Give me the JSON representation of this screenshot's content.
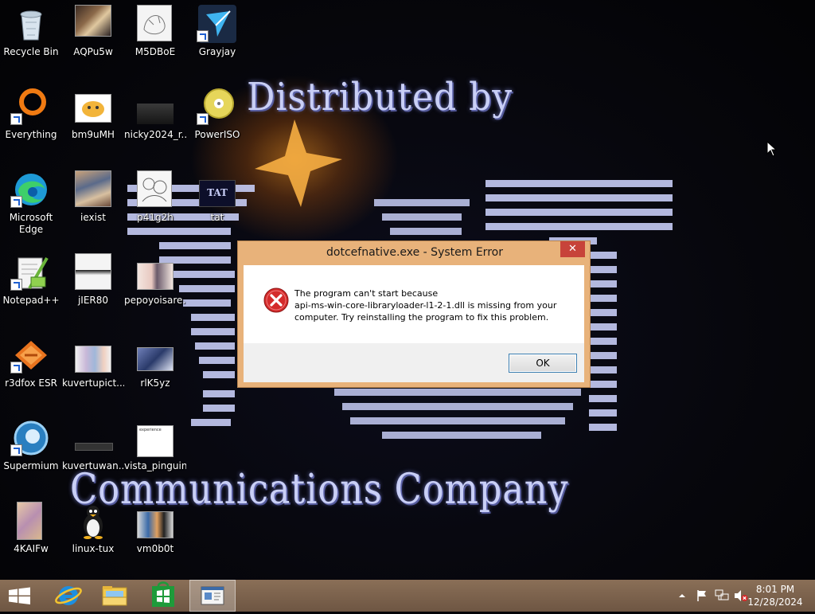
{
  "wallpaper": {
    "line_top": "Distributed by",
    "line_bottom": "Communications Company"
  },
  "desktop_icons": [
    {
      "label": "Recycle Bin",
      "icon": "recycle-bin-icon"
    },
    {
      "label": "AQPu5w",
      "icon": "image-thumbnail-icon"
    },
    {
      "label": "M5DBoE",
      "icon": "image-thumbnail-icon"
    },
    {
      "label": "Grayjay",
      "icon": "grayjay-icon"
    },
    {
      "label": "Everything",
      "icon": "everything-search-icon"
    },
    {
      "label": "bm9uMH",
      "icon": "image-thumbnail-icon"
    },
    {
      "label": "nicky2024_r...",
      "icon": "image-thumbnail-icon"
    },
    {
      "label": "PowerISO",
      "icon": "poweriso-disc-icon"
    },
    {
      "label": "Microsoft Edge",
      "icon": "edge-icon"
    },
    {
      "label": "iexist",
      "icon": "image-thumbnail-icon"
    },
    {
      "label": "p41g2h",
      "icon": "image-thumbnail-icon"
    },
    {
      "label": "tat",
      "icon": "image-thumbnail-icon"
    },
    {
      "label": "Notepad++",
      "icon": "notepad-plus-plus-icon"
    },
    {
      "label": "jIER80",
      "icon": "image-thumbnail-icon"
    },
    {
      "label": "pepoyoisare...",
      "icon": "image-thumbnail-icon"
    },
    {
      "label": "r3dfox ESR",
      "icon": "r3dfox-icon"
    },
    {
      "label": "kuvertupict...",
      "icon": "image-thumbnail-icon"
    },
    {
      "label": "rlK5yz",
      "icon": "image-thumbnail-icon"
    },
    {
      "label": "Supermium",
      "icon": "supermium-icon"
    },
    {
      "label": "kuvertuwan...",
      "icon": "image-thumbnail-icon"
    },
    {
      "label": "vista_pinguin",
      "icon": "image-thumbnail-icon"
    },
    {
      "label": "4KAIFw",
      "icon": "image-thumbnail-icon"
    },
    {
      "label": "linux-tux",
      "icon": "tux-penguin-icon"
    },
    {
      "label": "vm0b0t",
      "icon": "image-thumbnail-icon"
    }
  ],
  "thumb_text": {
    "tat": "TAT",
    "vista": "experience"
  },
  "dialog": {
    "title": "dotcefnative.exe - System Error",
    "close_glyph": "✕",
    "message_line1": "The program can't start because",
    "message_line2": "api-ms-win-core-libraryloader-l1-2-1.dll is missing from your",
    "message_line3": "computer. Try reinstalling the program to fix this problem.",
    "ok_label": "OK"
  },
  "taskbar": {
    "time": "8:01 PM",
    "date": "12/28/2024",
    "tray_icons": [
      "chevron-up-icon",
      "action-center-flag-icon",
      "network-icon",
      "volume-muted-icon"
    ],
    "pinned": [
      "internet-explorer-icon",
      "file-explorer-icon",
      "store-icon",
      "active-window-icon"
    ]
  },
  "colors": {
    "taskbar": "#7a6350",
    "dialog_frame": "#e8b27a",
    "close_button": "#c7433a",
    "ok_border": "#3c7fb1",
    "error_red": "#d42b2b"
  }
}
